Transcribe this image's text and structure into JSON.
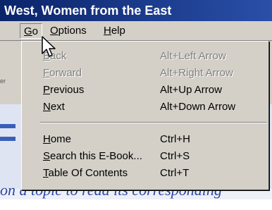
{
  "window": {
    "title": "West, Women from the East"
  },
  "menubar": {
    "items": [
      {
        "label_acc": "G",
        "label_rest": "o"
      },
      {
        "label_acc": "O",
        "label_rest": "ptions"
      },
      {
        "label_acc": "H",
        "label_rest": "elp"
      }
    ]
  },
  "background": {
    "left_edge_text": "er",
    "content_text": "on a topic to read its corresponding"
  },
  "go_menu": {
    "items": [
      {
        "label_acc": "B",
        "label_rest": "ack",
        "shortcut": "Alt+Left Arrow",
        "enabled": false
      },
      {
        "label_acc": "F",
        "label_rest": "orward",
        "shortcut": "Alt+Right Arrow",
        "enabled": false
      },
      {
        "label_acc": "P",
        "label_rest": "revious",
        "shortcut": "Alt+Up Arrow",
        "enabled": true
      },
      {
        "label_acc": "N",
        "label_rest": "ext",
        "shortcut": "Alt+Down Arrow",
        "enabled": true
      },
      {
        "label_acc": "H",
        "label_rest": "ome",
        "shortcut": "Ctrl+H",
        "enabled": true
      },
      {
        "label_acc": "S",
        "label_rest": "earch this E-Book...",
        "shortcut": "Ctrl+S",
        "enabled": true
      },
      {
        "label_acc": "T",
        "label_rest": "able Of Contents",
        "shortcut": "Ctrl+T",
        "enabled": true
      }
    ]
  },
  "colors": {
    "titlebar": "#0a246a",
    "menu_bg": "#d4d0c8",
    "disabled_text": "#808080",
    "content_text": "#2a47a0"
  },
  "icons": {
    "cursor": "arrow-cursor-icon"
  }
}
